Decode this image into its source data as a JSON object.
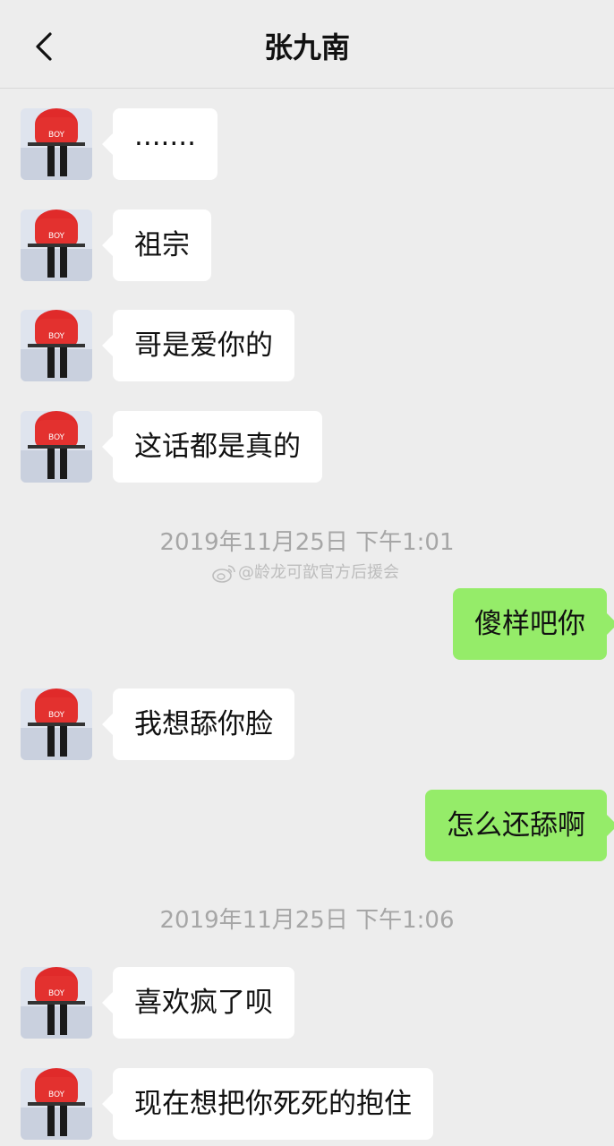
{
  "header": {
    "title": "张九南",
    "back_icon": "chevron-left-icon"
  },
  "messages": [
    {
      "side": "left",
      "text": "·······"
    },
    {
      "side": "left",
      "text": "祖宗"
    },
    {
      "side": "left",
      "text": "哥是爱你的"
    },
    {
      "side": "left",
      "text": "这话都是真的"
    },
    {
      "side": "right",
      "text": "傻样吧你"
    },
    {
      "side": "left",
      "text": "我想舔你脸"
    },
    {
      "side": "right",
      "text": "怎么还舔啊"
    },
    {
      "side": "left",
      "text": "喜欢疯了呗"
    },
    {
      "side": "left",
      "text": "现在想把你死死的抱住"
    }
  ],
  "timestamps": [
    "2019年11月25日 下午1:01",
    "2019年11月25日 下午1:06"
  ],
  "watermark": {
    "text": "@龄龙可歆官方后援会",
    "icon": "weibo-icon"
  },
  "colors": {
    "background": "#ededed",
    "incoming_bubble": "#ffffff",
    "outgoing_bubble": "#95ec69",
    "timestamp_text": "#a6a6a6"
  }
}
